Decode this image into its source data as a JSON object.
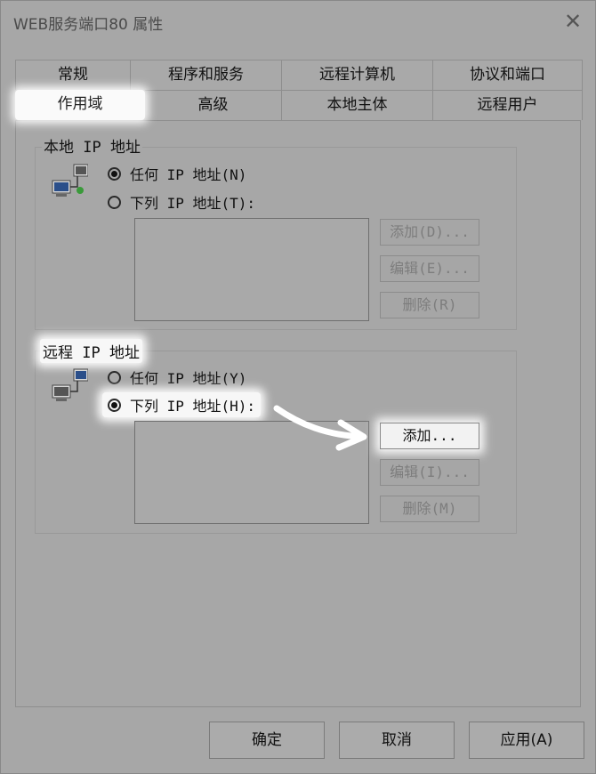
{
  "window": {
    "title": "WEB服务端口80 属性",
    "close_glyph": "✕"
  },
  "tabs": {
    "row1": [
      "常规",
      "程序和服务",
      "远程计算机",
      "协议和端口"
    ],
    "row2": [
      "作用域",
      "高级",
      "本地主体",
      "远程用户"
    ],
    "active": "作用域"
  },
  "local_ip": {
    "legend": "本地 IP 地址",
    "option_any": "任何 IP 地址(N)",
    "option_list": "下列 IP 地址(T):",
    "selected": "any",
    "buttons": {
      "add": "添加(D)...",
      "edit": "编辑(E)...",
      "remove": "删除(R)"
    }
  },
  "remote_ip": {
    "legend": "远程 IP 地址",
    "option_any": "任何 IP 地址(Y)",
    "option_list": "下列 IP 地址(H):",
    "selected": "list",
    "buttons": {
      "add": "添加...",
      "edit": "编辑(I)...",
      "remove": "删除(M)"
    }
  },
  "footer": {
    "ok": "确定",
    "cancel": "取消",
    "apply": "应用(A)"
  },
  "icons": {
    "network": "network-computers-icon",
    "arrow": "pointer-arrow"
  }
}
